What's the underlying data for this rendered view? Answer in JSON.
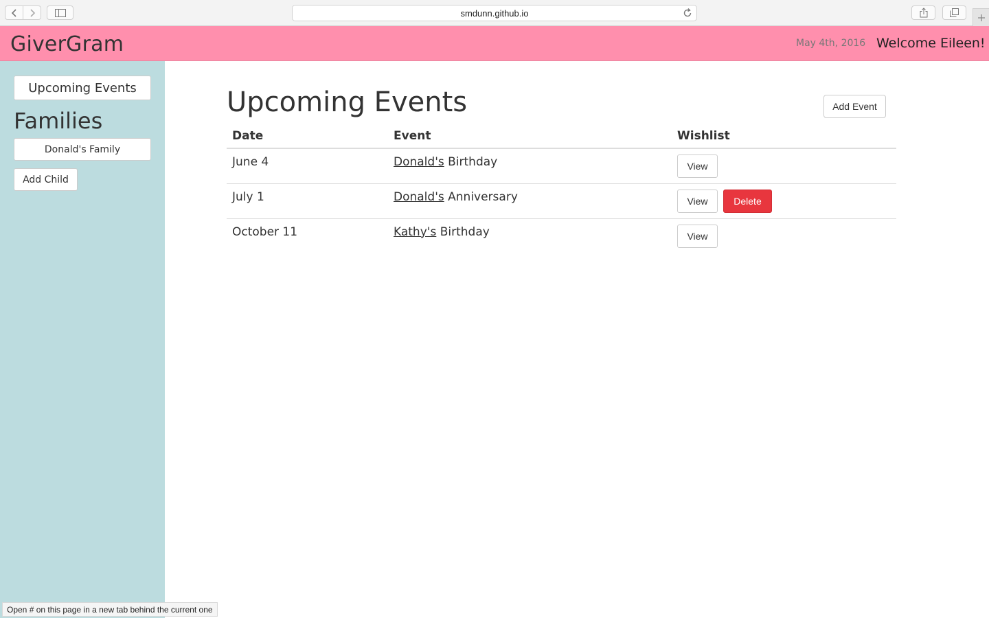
{
  "browser": {
    "url": "smdunn.github.io"
  },
  "header": {
    "brand": "GiverGram",
    "date": "May 4th, 2016",
    "welcome": "Welcome Eileen!"
  },
  "sidebar": {
    "upcoming_label": "Upcoming Events",
    "families_title": "Families",
    "families": [
      {
        "label": "Donald's Family"
      }
    ],
    "add_child_label": "Add Child"
  },
  "main": {
    "title": "Upcoming Events",
    "add_event_label": "Add Event",
    "columns": [
      "Date",
      "Event",
      "Wishlist"
    ],
    "rows": [
      {
        "date": "June 4",
        "person": "Donald's",
        "event": "Birthday",
        "view_label": "View",
        "delete_label": ""
      },
      {
        "date": "July 1",
        "person": "Donald's",
        "event": "Anniversary",
        "view_label": "View",
        "delete_label": "Delete"
      },
      {
        "date": "October 11",
        "person": "Kathy's",
        "event": "Birthday",
        "view_label": "View",
        "delete_label": ""
      }
    ]
  },
  "status_bar": {
    "text": "Open # on this page in a new tab behind the current one"
  },
  "colors": {
    "header": "#ff8fad",
    "sidebar": "#bcdcdf",
    "danger": "#e8363e"
  }
}
